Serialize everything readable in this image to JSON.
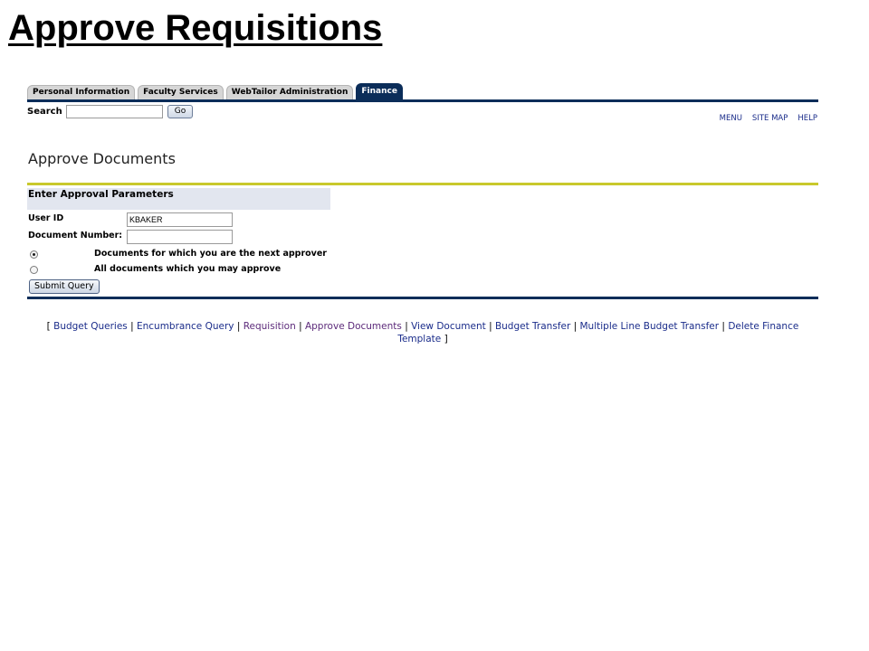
{
  "slide": {
    "title": "Approve Requisitions"
  },
  "tabs": [
    {
      "label": "Personal Information",
      "active": false
    },
    {
      "label": "Faculty Services",
      "active": false
    },
    {
      "label": "WebTailor Administration",
      "active": false
    },
    {
      "label": "Finance",
      "active": true
    }
  ],
  "search": {
    "label": "Search",
    "value": "",
    "go_label": "Go"
  },
  "top_links": {
    "menu": "MENU",
    "site_map": "SITE MAP",
    "help": "HELP"
  },
  "page": {
    "heading": "Approve Documents"
  },
  "form": {
    "section_title": "Enter Approval Parameters",
    "user_id_label": "User ID",
    "user_id_value": "KBAKER",
    "doc_number_label": "Document Number:",
    "doc_number_value": "",
    "radio_next_label": "Documents for which you are the next approver",
    "radio_all_label": "All documents which you may approve",
    "selected_option": "next_approver",
    "submit_label": "Submit Query"
  },
  "footer": {
    "open": "[ ",
    "close": " ]",
    "separator": " | ",
    "links": [
      "Budget Queries",
      "Encumbrance Query",
      "Requisition",
      "Approve Documents",
      "View Document",
      "Budget Transfer",
      "Multiple Line Budget Transfer",
      "Delete Finance Template"
    ]
  },
  "colors": {
    "navy": "#0b2d59",
    "olive": "#c9c92c",
    "link": "#1a2c8a",
    "visited_link": "#5c2a7a",
    "panel_bg": "#e2e6ef"
  }
}
